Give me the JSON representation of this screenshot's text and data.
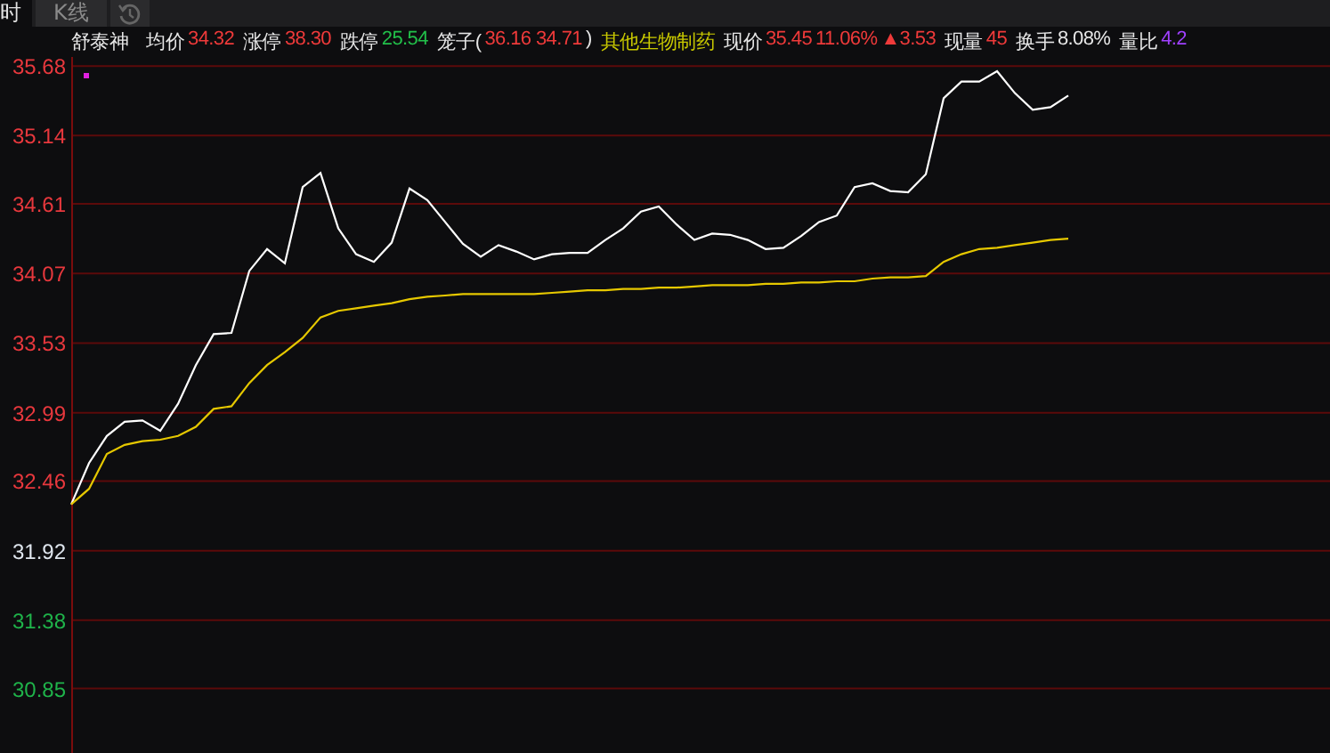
{
  "tabs": [
    {
      "label": "时",
      "selected": true
    },
    {
      "label": "K线",
      "selected": false
    }
  ],
  "quote": {
    "name": "舒泰神",
    "fields": [
      {
        "label": "均价",
        "values": [
          {
            "text": "34.32",
            "color": "#ef3a3a"
          }
        ]
      },
      {
        "label": "涨停",
        "values": [
          {
            "text": "38.30",
            "color": "#ef3a3a"
          }
        ]
      },
      {
        "label": "跌停",
        "values": [
          {
            "text": "25.54",
            "color": "#22c04a"
          }
        ]
      },
      {
        "label": "笼子(",
        "values": [
          {
            "text": "36.16 34.71",
            "color": "#ef3a3a"
          },
          {
            "text": ")",
            "color": "#e6e6e6"
          }
        ]
      },
      {
        "values": [
          {
            "text": "其他生物制药",
            "color": "#c8c800"
          }
        ]
      },
      {
        "label": "现价",
        "values": [
          {
            "text": "35.45",
            "color": "#ef3a3a"
          },
          {
            "text": "11.06%",
            "color": "#ef3a3a"
          },
          {
            "text": "▲3.53",
            "color": "#ef3a3a"
          }
        ]
      },
      {
        "label": "现量",
        "values": [
          {
            "text": "45",
            "color": "#ef3a3a"
          }
        ]
      },
      {
        "label": "换手",
        "values": [
          {
            "text": "8.08%",
            "color": "#e6e6e6"
          }
        ]
      },
      {
        "label": "量比",
        "values": [
          {
            "text": "4.2",
            "color": "#a040ff"
          }
        ]
      }
    ]
  },
  "chart_data": {
    "type": "line",
    "grid": true,
    "ylim": [
      30.35,
      35.75
    ],
    "yticks": [
      {
        "value": 35.68,
        "label": "35.68"
      },
      {
        "value": 35.14,
        "label": "35.14"
      },
      {
        "value": 34.61,
        "label": "34.61"
      },
      {
        "value": 34.07,
        "label": "34.07"
      },
      {
        "value": 33.53,
        "label": "33.53"
      },
      {
        "value": 32.99,
        "label": "32.99"
      },
      {
        "value": 32.46,
        "label": "32.46"
      },
      {
        "value": 31.92,
        "label": "31.92"
      },
      {
        "value": 31.38,
        "label": "31.38"
      },
      {
        "value": 30.85,
        "label": "30.85"
      }
    ],
    "series": [
      {
        "color": "#ffffff",
        "values": [
          32.28,
          32.6,
          32.81,
          32.92,
          32.93,
          32.85,
          33.06,
          33.36,
          33.6,
          33.61,
          34.09,
          34.26,
          34.15,
          34.74,
          34.85,
          34.42,
          34.22,
          34.16,
          34.31,
          34.73,
          34.64,
          34.47,
          34.3,
          34.2,
          34.29,
          34.24,
          34.18,
          34.22,
          34.23,
          34.23,
          34.33,
          34.42,
          34.55,
          34.59,
          34.45,
          34.33,
          34.38,
          34.37,
          34.33,
          34.26,
          34.27,
          34.36,
          34.47,
          34.52,
          34.74,
          34.77,
          34.71,
          34.7,
          34.84,
          35.43,
          35.56,
          35.56,
          35.64,
          35.47,
          35.34,
          35.36,
          35.45,
          null,
          null,
          null,
          null,
          null,
          null,
          null,
          null,
          null,
          null,
          null,
          null,
          null,
          null
        ]
      },
      {
        "color": "#e6c800",
        "values": [
          32.28,
          32.4,
          32.67,
          32.74,
          32.77,
          32.78,
          32.81,
          32.88,
          33.02,
          33.04,
          33.22,
          33.36,
          33.46,
          33.57,
          33.73,
          33.78,
          33.8,
          33.82,
          33.84,
          33.87,
          33.89,
          33.9,
          33.91,
          33.91,
          33.91,
          33.91,
          33.91,
          33.92,
          33.93,
          33.94,
          33.94,
          33.95,
          33.95,
          33.96,
          33.96,
          33.97,
          33.98,
          33.98,
          33.98,
          33.99,
          33.99,
          34.0,
          34.0,
          34.01,
          34.01,
          34.03,
          34.04,
          34.04,
          34.05,
          34.16,
          34.22,
          34.26,
          34.27,
          34.29,
          34.31,
          34.33,
          34.34,
          null,
          null,
          null,
          null,
          null,
          null,
          null,
          null,
          null,
          null,
          null,
          null,
          null,
          null
        ]
      }
    ]
  }
}
